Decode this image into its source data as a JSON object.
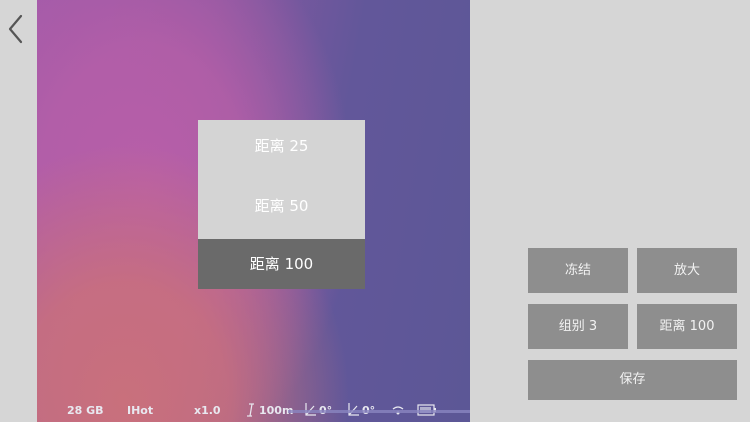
{
  "dropdown": {
    "options": [
      "距离 25",
      "距离 50",
      "距离 100"
    ],
    "selected": "距离 100"
  },
  "status": {
    "storage": "28 GB",
    "palette": "IHot",
    "zoom": "x1.0",
    "distance": "100m",
    "angle1": "0°",
    "angle2": "0°"
  },
  "controls": {
    "freeze": "冻结",
    "zoom_in": "放大",
    "group": "组别 3",
    "distance": "距离 100",
    "save": "保存"
  },
  "colors": {
    "button_bg": "#8e8e8e",
    "selected_option": "#6a6a6a",
    "option_bg": "#d4d4d4",
    "page_bg": "#d6d6d6"
  }
}
